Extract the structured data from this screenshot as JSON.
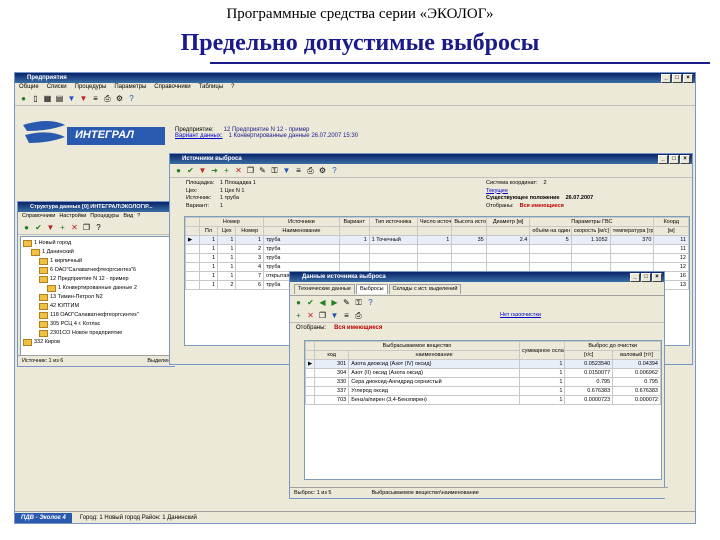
{
  "slide": {
    "subtitle": "Программные средства серии «ЭКОЛОГ»",
    "title": "Предельно допустимые выбросы"
  },
  "main_window": {
    "title": "Предприятия",
    "menu": [
      "Общие",
      "Списки",
      "Процедуры",
      "Параметры",
      "Справочники",
      "Таблицы",
      "?"
    ],
    "logo_text": "ИНТЕГРАЛ",
    "enterprise_label": "Предприятие:",
    "enterprise_value": "12 Предприятие N 12 - пример",
    "variant_label": "Вариант данных:",
    "variant_value": "1 Конвертированные данные 26.07.2007 15:30"
  },
  "structure_window": {
    "title": "Структура данных [0] ИНТЕГРАЛ\\ЭКОЛОГ\\Р...",
    "menu": [
      "Справочники",
      "Настройки",
      "Процедуры",
      "Вид",
      "?"
    ],
    "tree": [
      {
        "level": 0,
        "text": "1 Новый город"
      },
      {
        "level": 1,
        "text": "1 Данинский"
      },
      {
        "level": 2,
        "text": "1 кирпичный"
      },
      {
        "level": 2,
        "text": "6 ОАО\"Салаватнефтеоргсинтез\"6"
      },
      {
        "level": 2,
        "text": "12 Предприятие N 12 - пример"
      },
      {
        "level": 3,
        "text": "1 Конвертированные данные 2"
      },
      {
        "level": 2,
        "text": "13 Тимин-Петрол N2"
      },
      {
        "level": 2,
        "text": "42 ЮПТИМ"
      },
      {
        "level": 2,
        "text": "118 ОАО\"Салаватнефтеоргсинтез\""
      },
      {
        "level": 2,
        "text": "305 РСЦ 4 г. Котлас"
      },
      {
        "level": 2,
        "text": "2301СО Новое предприятие"
      },
      {
        "level": 0,
        "text": "332 Киров"
      }
    ],
    "status_left": "Источник: 1 из 6",
    "status_right": "Выделено 0"
  },
  "sources_window": {
    "title": "Источники выброса",
    "info": {
      "site_label": "Площадка:",
      "site_value": "1 Площадка 1",
      "shop_label": "Цех:",
      "shop_value": "1 Цех N 1",
      "source_label": "Источник:",
      "source_value": "1 труба",
      "variant_label": "Вариант:",
      "variant_value": "1",
      "coord_label": "Система координат:",
      "coord_value": "2",
      "current_label": "Текущее",
      "existing_label": "Существующее положение",
      "existing_value": "26.07.2007",
      "selected_label": "Отобраны:",
      "selected_value": "Вся имеющиеся"
    },
    "headers": {
      "number": "Номер",
      "sources": "Источники",
      "variant": "Вариант",
      "type": "Тип источника",
      "count": "Число источников",
      "height": "Высота источника",
      "diameter": "Диаметр [м]",
      "gvs": "Параметры ГВС",
      "coords": "Коорд",
      "pl": "Пл",
      "shop": "Цех",
      "num": "Номер",
      "name": "Наименование",
      "flow": "объём на один источник [куб.м/с]",
      "speed": "скорость [м/с]",
      "temp": "температура [гр. С]",
      "units": "[м]"
    },
    "rows": [
      {
        "pl": "1",
        "shop": "1",
        "num": "1",
        "name": "труба",
        "variant": "1",
        "type": "1 Точечный",
        "count": "1",
        "height": "35",
        "diam": "2.4",
        "flow": "5",
        "speed": "1.1052",
        "temp": "370",
        "coord": "11"
      },
      {
        "pl": "1",
        "shop": "1",
        "num": "2",
        "name": "труба",
        "variant": "",
        "type": "",
        "count": "",
        "height": "",
        "diam": "",
        "flow": "",
        "speed": "",
        "temp": "",
        "coord": "11"
      },
      {
        "pl": "1",
        "shop": "1",
        "num": "3",
        "name": "труба",
        "variant": "",
        "type": "",
        "count": "",
        "height": "",
        "diam": "",
        "flow": "",
        "speed": "",
        "temp": "",
        "coord": "12"
      },
      {
        "pl": "1",
        "shop": "1",
        "num": "4",
        "name": "труба",
        "variant": "",
        "type": "",
        "count": "",
        "height": "",
        "diam": "",
        "flow": "",
        "speed": "",
        "temp": "",
        "coord": "12"
      },
      {
        "pl": "1",
        "shop": "1",
        "num": "7",
        "name": "открытая ст",
        "variant": "",
        "type": "",
        "count": "",
        "height": "",
        "diam": "",
        "flow": "",
        "speed": "",
        "temp": "",
        "coord": "16"
      },
      {
        "pl": "1",
        "shop": "2",
        "num": "6",
        "name": "труба",
        "variant": "",
        "type": "",
        "count": "",
        "height": "",
        "diam": "",
        "flow": "",
        "speed": "",
        "temp": "",
        "coord": "13"
      }
    ]
  },
  "emissions_window": {
    "title": "Данные источника выброса",
    "tabs": [
      "Технические данные",
      "Выбросы",
      "Склады с ист. выделений"
    ],
    "link": "Нет газоочистки",
    "selected_label": "Отобраны:",
    "selected_value": "Вся имеющиеся",
    "headers": {
      "substance": "Выбрасываемое вещество",
      "code": "код",
      "name": "наименование",
      "summer": "суммарное ослабление",
      "purification": "Выброс до очистки",
      "gs": "[г/с]",
      "ty": "валовый [т/г]"
    },
    "rows": [
      {
        "code": "301",
        "name": "Азота диоксид (Азот (IV) оксид)",
        "sum": "1",
        "gs": "0.0523540",
        "ty": "0.04394"
      },
      {
        "code": "304",
        "name": "Азот (II) оксид (Азота оксид)",
        "sum": "1",
        "gs": "0.0150077",
        "ty": "0.006962"
      },
      {
        "code": "330",
        "name": "Сера диоксид-Ангидрид сернистый",
        "sum": "1",
        "gs": "0.795",
        "ty": "0.795"
      },
      {
        "code": "337",
        "name": "Углерод оксид",
        "sum": "1",
        "gs": "0.676383",
        "ty": "0.676383"
      },
      {
        "code": "703",
        "name": "Бенз/а/пирен (3,4-Бензпирен)",
        "sum": "1",
        "gs": "0.0000723",
        "ty": "0.000072"
      }
    ],
    "status_left": "Выброс: 1 из 5",
    "status_right": "Выбрасываемое вещество\\наименование"
  },
  "taskbar": {
    "app": "ПДВ - Эколог 4",
    "path": "Город: 1 Новый город Район: 1 Данинский"
  },
  "colors": {
    "title_blue": "#1a1a8c",
    "window_bg": "#ece9d8",
    "titlebar": "#0a246a",
    "highlight_red": "#c00000"
  }
}
